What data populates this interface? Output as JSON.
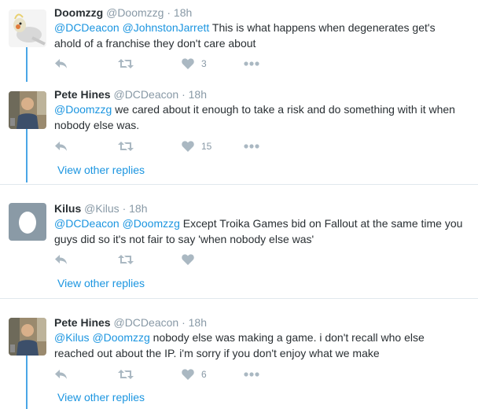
{
  "tweets": [
    {
      "name": "Doomzzg",
      "handle": "@Doomzzg",
      "sep": "·",
      "time": "18h",
      "mentions": [
        "@DCDeacon",
        "@JohnstonJarrett"
      ],
      "text": " This is what happens when degenerates get's ahold of a franchise they don't care about",
      "likes": "3",
      "avatar": "cockatiel-avatar"
    },
    {
      "name": "Pete Hines",
      "handle": "@DCDeacon",
      "sep": "·",
      "time": "18h",
      "mentions": [
        "@Doomzzg"
      ],
      "text": " we cared about it enough to take a risk and do something with it when nobody else was.",
      "likes": "15",
      "avatar": "pete-hines-avatar",
      "view_replies": "View other replies"
    },
    {
      "name": "Kilus",
      "handle": "@Kilus",
      "sep": "·",
      "time": "18h",
      "mentions": [
        "@DCDeacon",
        "@Doomzzg"
      ],
      "text": " Except Troika Games bid on Fallout at the same time you guys did so it's not fair to say 'when nobody else was'",
      "likes": "",
      "avatar": "egg-avatar",
      "view_replies": "View other replies"
    },
    {
      "name": "Pete Hines",
      "handle": "@DCDeacon",
      "sep": "·",
      "time": "18h",
      "mentions": [
        "@Kilus",
        "@Doomzzg"
      ],
      "text": " nobody else was making a game. i don't recall who else reached out about the IP. i'm sorry if you don't enjoy what we make",
      "likes": "6",
      "avatar": "pete-hines-avatar",
      "view_replies": "View other replies"
    }
  ],
  "colors": {
    "link": "#1b95e0",
    "thread_line": "#4aa6e6",
    "icon": "#aab8c2",
    "name": "#292f33",
    "meta": "#8899a6"
  }
}
